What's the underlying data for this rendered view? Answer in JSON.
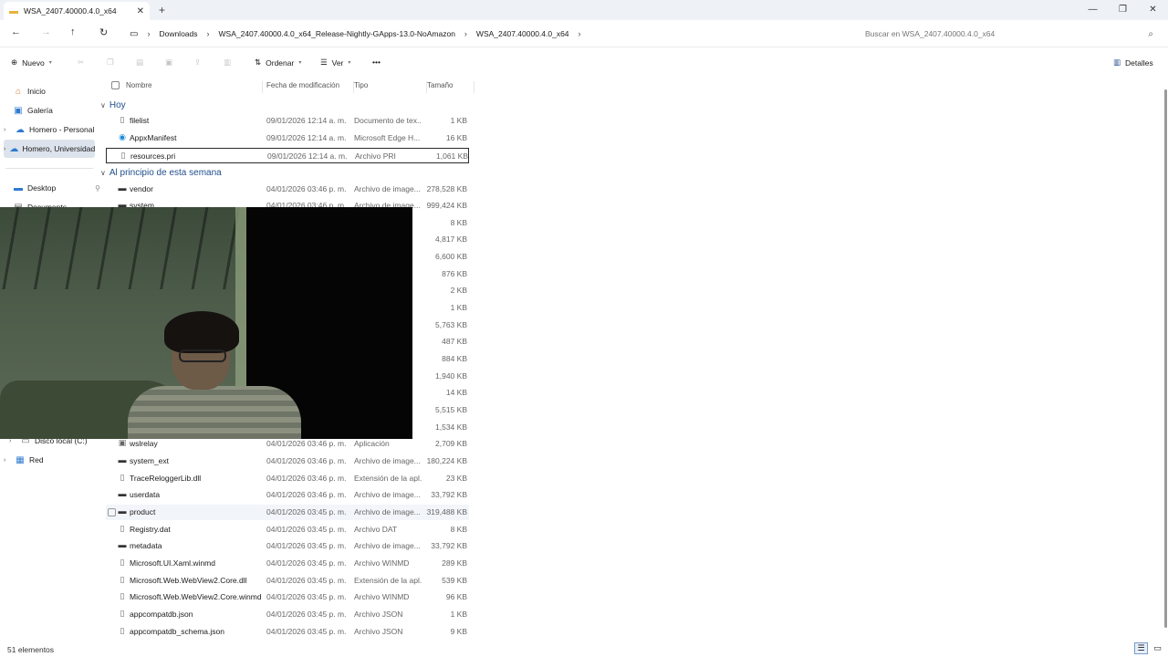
{
  "window": {
    "tab_title": "WSA_2407.40000.4.0_x64",
    "new_tab_icon": "plus-icon",
    "controls": [
      "—",
      "❐",
      "✕"
    ]
  },
  "address_bar": {
    "crumbs": [
      "Downloads",
      "WSA_2407.40000.4.0_x64_Release-Nightly-GApps-13.0-NoAmazon",
      "WSA_2407.40000.4.0_x64"
    ],
    "search_placeholder": "Buscar en WSA_2407.40000.4.0_x64"
  },
  "command_bar": {
    "new_label": "Nuevo",
    "sort_label": "Ordenar",
    "view_label": "Ver",
    "more_label": "•••",
    "details_label": "Detalles"
  },
  "sidebar": {
    "items": [
      {
        "label": "Inicio",
        "icon": "home-icon"
      },
      {
        "label": "Galería",
        "icon": "gallery-icon"
      },
      {
        "label": "Homero - Personal",
        "icon": "cloud-icon"
      },
      {
        "label": "Homero, Universidad",
        "icon": "cloud-icon"
      },
      {
        "label": "Desktop",
        "icon": "desktop-icon"
      },
      {
        "label": "Documents",
        "icon": "documents-icon"
      },
      {
        "label": "Disco local (C:)",
        "icon": "drive-icon"
      },
      {
        "label": "Red",
        "icon": "network-icon"
      }
    ]
  },
  "columns": {
    "name": "Nombre",
    "date": "Fecha de modificación",
    "type": "Tipo",
    "size": "Tamaño"
  },
  "groups": {
    "today": "Hoy",
    "earlier": "Al principio de esta semana"
  },
  "files_today": [
    {
      "name": "filelist",
      "date": "09/01/2026 12:14 a. m.",
      "type": "Documento de tex...",
      "size": "1 KB",
      "icon": "file-icon"
    },
    {
      "name": "AppxManifest",
      "date": "09/01/2026 12:14 a. m.",
      "type": "Microsoft Edge H...",
      "size": "16 KB",
      "icon": "edge-icon"
    },
    {
      "name": "resources.pri",
      "date": "09/01/2026 12:14 a. m.",
      "type": "Archivo PRI",
      "size": "1,061 KB",
      "icon": "file-icon"
    }
  ],
  "files_earlier": [
    {
      "name": "vendor",
      "date": "04/01/2026 03:46 p. m.",
      "type": "Archivo de image...",
      "size": "278,528 KB",
      "icon": "disk-image-icon"
    },
    {
      "name": "system",
      "date": "04/01/2026 03:46 p. m.",
      "type": "Archivo de image...",
      "size": "999,424 KB",
      "icon": "disk-image-icon"
    }
  ],
  "hidden_sizes": [
    "8 KB",
    "4,817 KB",
    "6,600 KB",
    "876 KB",
    "2 KB",
    "1 KB",
    "5,763 KB",
    "487 KB",
    "884 KB",
    "1,940 KB",
    "14 KB",
    "5,515 KB",
    "1,534 KB"
  ],
  "files_lower": [
    {
      "name": "wslrelay",
      "date": "04/01/2026 03:46 p. m.",
      "type": "Aplicación",
      "size": "2,709 KB",
      "icon": "app-icon"
    },
    {
      "name": "system_ext",
      "date": "04/01/2026 03:46 p. m.",
      "type": "Archivo de image...",
      "size": "180,224 KB",
      "icon": "disk-image-icon"
    },
    {
      "name": "TraceReloggerLib.dll",
      "date": "04/01/2026 03:46 p. m.",
      "type": "Extensión de la apl...",
      "size": "23 KB",
      "icon": "file-icon"
    },
    {
      "name": "userdata",
      "date": "04/01/2026 03:46 p. m.",
      "type": "Archivo de image...",
      "size": "33,792 KB",
      "icon": "disk-image-icon"
    },
    {
      "name": "product",
      "date": "04/01/2026 03:45 p. m.",
      "type": "Archivo de image...",
      "size": "319,488 KB",
      "icon": "disk-image-icon"
    },
    {
      "name": "Registry.dat",
      "date": "04/01/2026 03:45 p. m.",
      "type": "Archivo DAT",
      "size": "8 KB",
      "icon": "file-icon"
    },
    {
      "name": "metadata",
      "date": "04/01/2026 03:45 p. m.",
      "type": "Archivo de image...",
      "size": "33,792 KB",
      "icon": "disk-image-icon"
    },
    {
      "name": "Microsoft.UI.Xaml.winmd",
      "date": "04/01/2026 03:45 p. m.",
      "type": "Archivo WINMD",
      "size": "289 KB",
      "icon": "file-icon"
    },
    {
      "name": "Microsoft.Web.WebView2.Core.dll",
      "date": "04/01/2026 03:45 p. m.",
      "type": "Extensión de la apl...",
      "size": "539 KB",
      "icon": "file-icon"
    },
    {
      "name": "Microsoft.Web.WebView2.Core.winmd",
      "date": "04/01/2026 03:45 p. m.",
      "type": "Archivo WINMD",
      "size": "96 KB",
      "icon": "file-icon"
    },
    {
      "name": "appcompatdb.json",
      "date": "04/01/2026 03:45 p. m.",
      "type": "Archivo JSON",
      "size": "1 KB",
      "icon": "file-icon"
    },
    {
      "name": "appcompatdb_schema.json",
      "date": "04/01/2026 03:45 p. m.",
      "type": "Archivo JSON",
      "size": "9 KB",
      "icon": "file-icon"
    }
  ],
  "status": {
    "count": "51 elementos"
  },
  "colors": {
    "accent": "#1f4e8c",
    "selection": "#dde3ec",
    "titlebar": "#eef1f6"
  }
}
